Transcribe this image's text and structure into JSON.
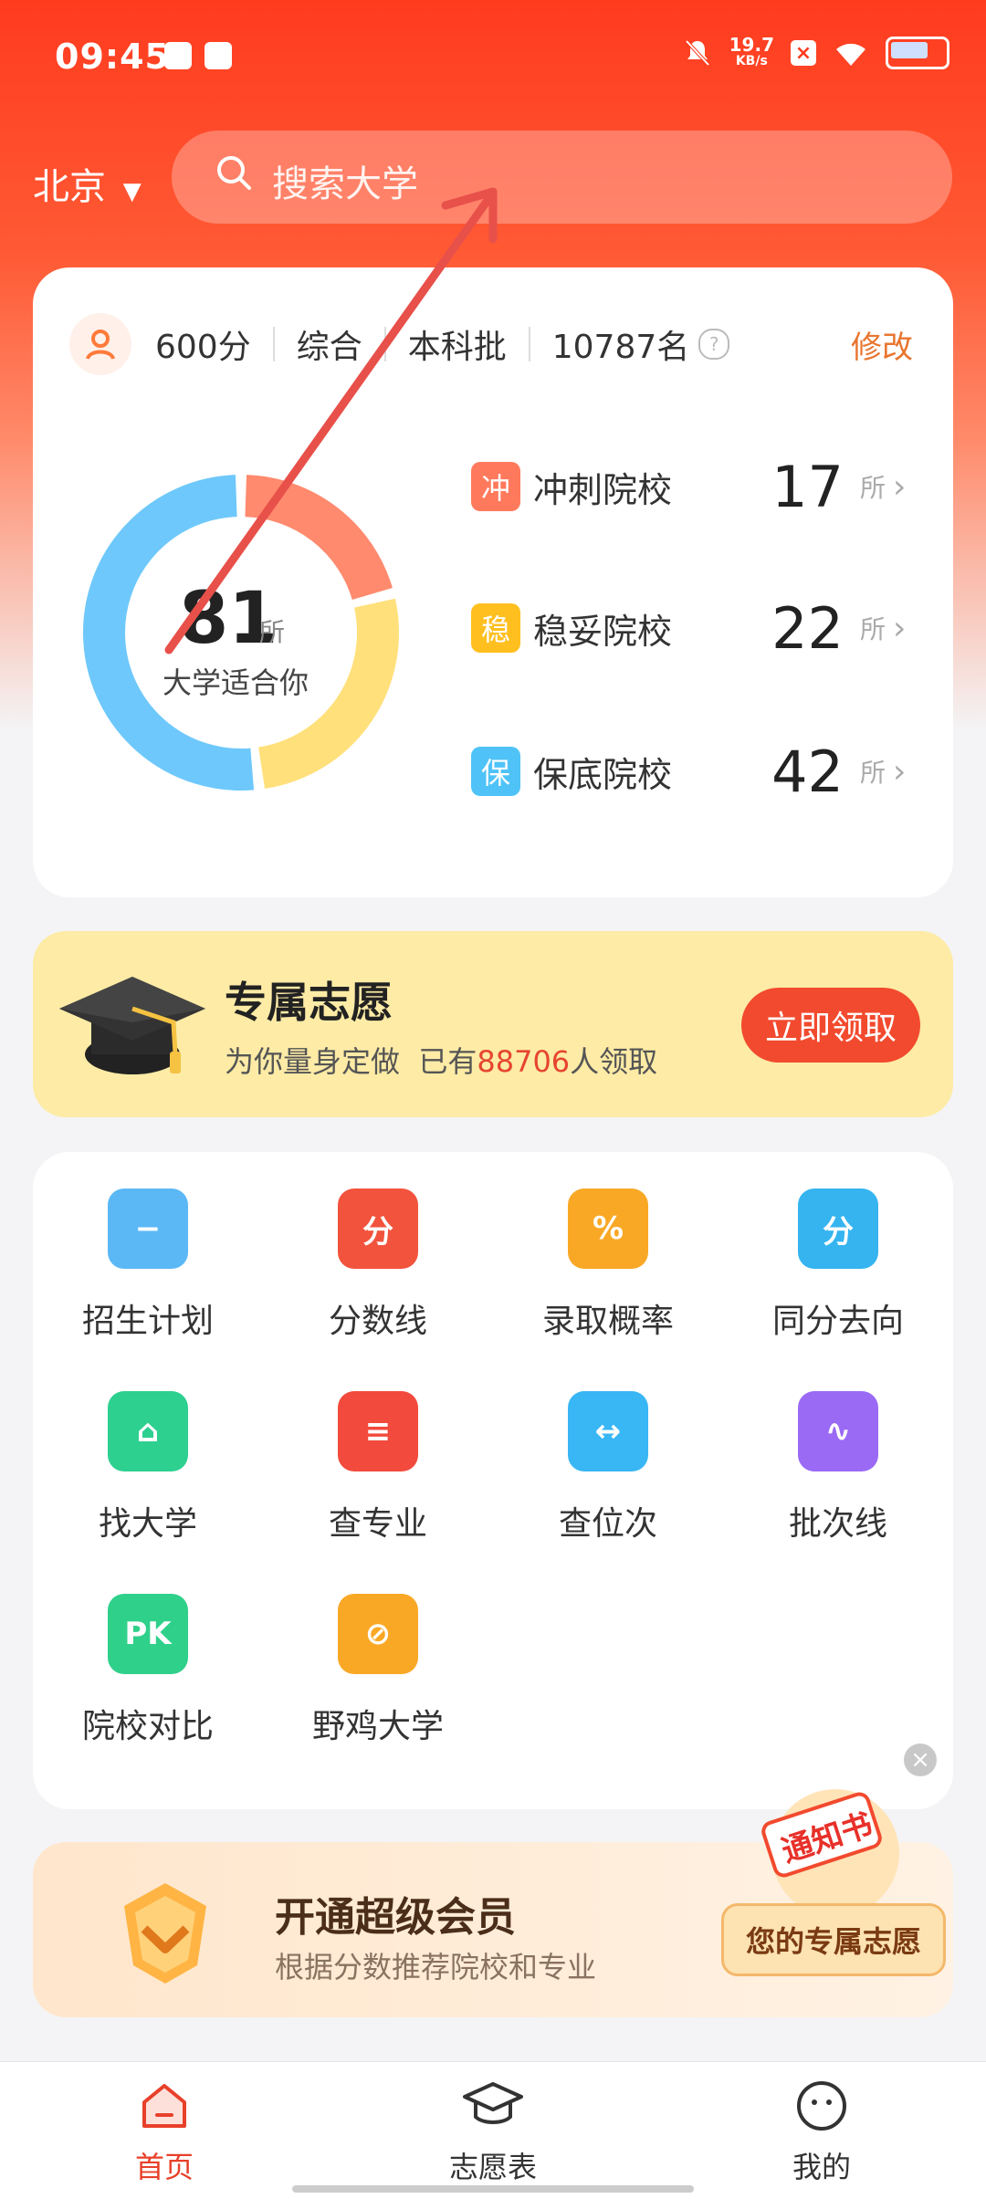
{
  "status_bar": {
    "time": "09:45",
    "network_speed": "19.7\nKB/s",
    "network_speed_value": "19.7",
    "network_speed_unit": "KB/s"
  },
  "header": {
    "city": "北京",
    "search_placeholder": "搜索大学"
  },
  "score_card": {
    "score": "600分",
    "subject": "综合",
    "batch": "本科批",
    "rank": "10787名",
    "edit_label": "修改",
    "donut": {
      "count": "81",
      "unit": "所",
      "label": "大学适合你",
      "segments": [
        {
          "name": "冲刺院校",
          "value": 17,
          "color": "#ff8a6e"
        },
        {
          "name": "稳妥院校",
          "value": 22,
          "color": "#ffe07a"
        },
        {
          "name": "保底院校",
          "value": 42,
          "color": "#6ec8fb"
        }
      ]
    },
    "tiers": [
      {
        "badge": "冲",
        "name": "冲刺院校",
        "count": "17",
        "unit": "所",
        "color": "#ff7a5c"
      },
      {
        "badge": "稳",
        "name": "稳妥院校",
        "count": "22",
        "unit": "所",
        "color": "#ffbf1f"
      },
      {
        "badge": "保",
        "name": "保底院校",
        "count": "42",
        "unit": "所",
        "color": "#4fc3f7"
      }
    ]
  },
  "promo": {
    "title": "专属志愿",
    "sub_prefix": "为你量身定做  已有",
    "sub_count": "88706",
    "sub_suffix": "人领取",
    "button": "立即领取"
  },
  "tools": [
    {
      "label": "招生计划",
      "icon": "graduation-cap-icon",
      "color": "#5bb8f5",
      "glyph": "−"
    },
    {
      "label": "分数线",
      "icon": "score-icon",
      "color": "#f2533c",
      "glyph": "分"
    },
    {
      "label": "录取概率",
      "icon": "percent-bag-icon",
      "color": "#f9a826",
      "glyph": "%"
    },
    {
      "label": "同分去向",
      "icon": "same-score-icon",
      "color": "#35b4f0",
      "glyph": "分"
    },
    {
      "label": "找大学",
      "icon": "university-building-icon",
      "color": "#2dd08f",
      "glyph": "⌂"
    },
    {
      "label": "查专业",
      "icon": "book-icon",
      "color": "#f24a3c",
      "glyph": "≡"
    },
    {
      "label": "查位次",
      "icon": "rank-ruler-icon",
      "color": "#39b6f4",
      "glyph": "↔"
    },
    {
      "label": "批次线",
      "icon": "batch-line-icon",
      "color": "#9a6af5",
      "glyph": "∿"
    },
    {
      "label": "院校对比",
      "icon": "pk-heart-icon",
      "color": "#2fd08a",
      "glyph": "PK"
    },
    {
      "label": "野鸡大学",
      "icon": "fake-university-icon",
      "color": "#f9a826",
      "glyph": "⊘"
    }
  ],
  "vip": {
    "title": "开通超级会员",
    "sub": "根据分数推荐院校和专业",
    "float_pill": "您的专属志愿",
    "notice_text": "通知书"
  },
  "nav": [
    {
      "label": "首页",
      "icon": "home-icon",
      "active": true
    },
    {
      "label": "志愿表",
      "icon": "graduation-cap-icon",
      "active": false
    },
    {
      "label": "我的",
      "icon": "smiley-face-icon",
      "active": false
    }
  ],
  "colors": {
    "accent": "#f24a2e",
    "nav_active": "#e8402a"
  }
}
